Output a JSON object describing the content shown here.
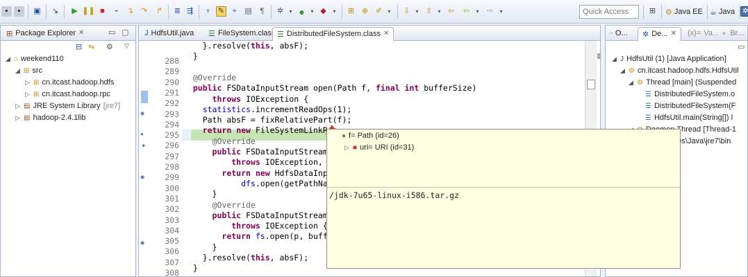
{
  "toolbar": {
    "quick_access_placeholder": "Quick Access",
    "perspectives": [
      {
        "label": "Java EE"
      },
      {
        "label": "Java"
      }
    ]
  },
  "package_explorer": {
    "tab_label": "Package Explorer",
    "tree": [
      {
        "label": "weekend110",
        "level": 0,
        "expanded": true,
        "icon": "project-icon"
      },
      {
        "label": "src",
        "level": 1,
        "expanded": true,
        "icon": "source-folder-icon"
      },
      {
        "label": "cn.itcast.hadoop.hdfs",
        "level": 2,
        "expanded": false,
        "icon": "package-icon"
      },
      {
        "label": "cn.itcast.hadoop.rpc",
        "level": 2,
        "expanded": false,
        "icon": "package-icon"
      },
      {
        "label": "JRE System Library",
        "decoration": "[jre7]",
        "level": 1,
        "expanded": false,
        "icon": "library-icon"
      },
      {
        "label": "hadoop-2.4.1lib",
        "level": 1,
        "expanded": false,
        "icon": "library-icon"
      }
    ]
  },
  "editor": {
    "tabs": [
      {
        "label": "HdfsUtil.java",
        "active": false,
        "icon": "java-file-icon"
      },
      {
        "label": "FileSystem.class",
        "active": false,
        "icon": "class-file-icon"
      },
      {
        "label": "DistributedFileSystem.class",
        "active": true,
        "icon": "class-file-icon"
      }
    ],
    "lines": [
      {
        "n": "288",
        "code": "    }.resolve(this, absF);"
      },
      {
        "n": "289",
        "code": "  }"
      },
      {
        "n": "290",
        "code": ""
      },
      {
        "n": "291",
        "code": "  @Override"
      },
      {
        "n": "292",
        "code": "  public FSDataInputStream open(Path f, final int bufferSize)"
      },
      {
        "n": "293",
        "code": "      throws IOException {"
      },
      {
        "n": "294",
        "code": "    statistics.incrementReadOps(1);"
      },
      {
        "n": "295",
        "code": "    Path absF = fixRelativePart(f);"
      },
      {
        "n": "296",
        "code": "    return new FileSystemLinkRes"
      },
      {
        "n": "297",
        "code": "      @Override"
      },
      {
        "n": "298",
        "code": "      public FSDataInputStream d"
      },
      {
        "n": "299",
        "code": "          throws IOException, Un"
      },
      {
        "n": "300",
        "code": "        return new HdfsDataInput"
      },
      {
        "n": "301",
        "code": "            dfs.open(getPathName"
      },
      {
        "n": "302",
        "code": "      }"
      },
      {
        "n": "303",
        "code": "      @Override"
      },
      {
        "n": "304",
        "code": "      public FSDataInputStream n"
      },
      {
        "n": "305",
        "code": "          throws IOException {"
      },
      {
        "n": "306",
        "code": "        return fs.open(p, buffer"
      },
      {
        "n": "307",
        "code": "      }"
      },
      {
        "n": "308",
        "code": "    }.resolve(this, absF);"
      },
      {
        "n": "309",
        "code": "  }"
      }
    ]
  },
  "hover": {
    "tree": [
      {
        "label": "f= Path  (id=26)",
        "level": 0,
        "icon": "variable-icon"
      },
      {
        "label": "uri= URI  (id=31)",
        "level": 1,
        "icon": "field-icon"
      }
    ],
    "detail": "/jdk-7u65-linux-i586.tar.gz"
  },
  "debug": {
    "tabs": [
      {
        "label": "O...",
        "active": false
      },
      {
        "label": "De...",
        "active": true
      },
      {
        "label": "Va...",
        "active": false
      },
      {
        "label": "Br...",
        "active": false
      }
    ],
    "tree": [
      {
        "label": "HdfsUtil (1) [Java Application]",
        "level": 0,
        "icon": "launch-icon"
      },
      {
        "label": "cn.itcast.hadoop.hdfs.HdfsUtil",
        "level": 1,
        "icon": "vm-icon"
      },
      {
        "label": "Thread [main] (Suspended",
        "level": 2,
        "icon": "thread-icon"
      },
      {
        "label": "DistributedFileSystem.o",
        "level": 3,
        "icon": "stack-frame-icon"
      },
      {
        "label": "DistributedFileSystem(F",
        "level": 3,
        "icon": "stack-frame-icon"
      },
      {
        "label": "HdfsUtil.main(String[]) l",
        "level": 3,
        "icon": "stack-frame-icon"
      },
      {
        "label": "Daemon Thread [Thread-1",
        "level": 2,
        "icon": "thread-icon"
      },
      {
        "label": "Program Files\\Java\\jre7\\bin",
        "level": 1,
        "icon": "process-icon"
      }
    ]
  },
  "colors": {
    "keyword": "#7f0055",
    "annotation": "#646464",
    "field": "#0000c0",
    "current_line": "#c7e4b4",
    "hover_bg": "#ffffe1"
  }
}
